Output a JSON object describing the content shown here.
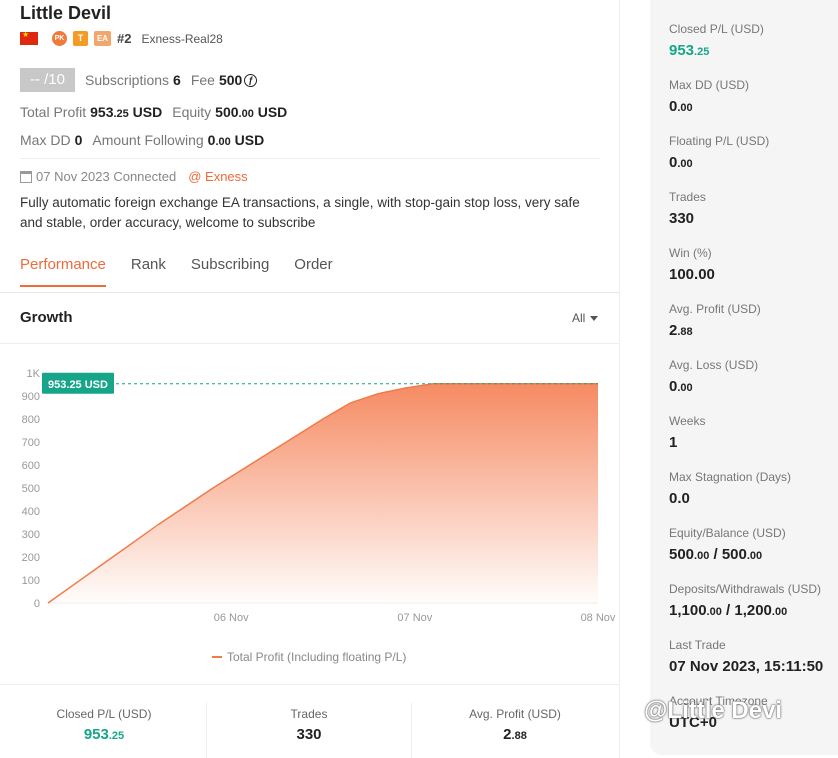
{
  "header": {
    "title": "Little Devil",
    "badges": [
      "PK",
      "T",
      "EA"
    ],
    "rank": "#2",
    "account": "Exness-Real28"
  },
  "summary": {
    "score": "-- /10",
    "subscriptions_label": "Subscriptions",
    "subscriptions_value": "6",
    "fee_label": "Fee",
    "fee_value": "500",
    "fee_icon": "ƒ",
    "total_profit_label": "Total Profit",
    "total_profit_int": "953",
    "total_profit_dec": ".25",
    "total_profit_unit": " USD",
    "equity_label": "Equity",
    "equity_int": "500",
    "equity_dec": ".00",
    "equity_unit": " USD",
    "maxdd_label": "Max DD",
    "maxdd_value": "0",
    "amount_following_label": "Amount Following",
    "amount_following_int": "0",
    "amount_following_dec": ".00",
    "amount_following_unit": " USD"
  },
  "connection": {
    "date": "07 Nov 2023 Connected",
    "broker": "@ Exness"
  },
  "description": "Fully automatic foreign exchange EA transactions, a single, with stop-gain stop loss, very safe and stable, order accuracy, welcome to subscribe",
  "tabs": [
    {
      "label": "Performance",
      "active": true
    },
    {
      "label": "Rank",
      "active": false
    },
    {
      "label": "Subscribing",
      "active": false
    },
    {
      "label": "Order",
      "active": false
    }
  ],
  "growth": {
    "title": "Growth",
    "range": "All"
  },
  "chart_data": {
    "type": "area",
    "title": "",
    "xlabel": "",
    "ylabel": "",
    "ylim": [
      0,
      1000
    ],
    "yticks": [
      "0",
      "100",
      "200",
      "300",
      "400",
      "500",
      "600",
      "700",
      "800",
      "900",
      "1K"
    ],
    "xticks": [
      "06 Nov",
      "07 Nov",
      "08 Nov"
    ],
    "x": [
      0,
      0.1,
      0.2,
      0.3,
      0.4,
      0.5,
      0.55,
      0.6,
      0.65,
      0.7,
      0.75,
      1.0
    ],
    "series": [
      {
        "name": "Total Profit (Including floating P/L)",
        "values": [
          0,
          170,
          340,
          500,
          650,
          800,
          870,
          910,
          935,
          953.25,
          953.25,
          953.25
        ]
      }
    ],
    "annotation": "953.25 USD",
    "legend_position": "bottom",
    "colors": {
      "line": "#f07a4a",
      "fill_top": "#f5845a",
      "label_bg": "#17a589"
    }
  },
  "bottom_stats": [
    {
      "label": "Closed P/L (USD)",
      "int": "953",
      "dec": ".25",
      "green": true
    },
    {
      "label": "Trades",
      "int": "330",
      "dec": "",
      "green": false
    },
    {
      "label": "Avg. Profit (USD)",
      "int": "2",
      "dec": ".88",
      "green": false
    }
  ],
  "sidebar": [
    {
      "label": "Closed P/L (USD)",
      "int": "953",
      "dec": ".25",
      "green": true
    },
    {
      "label": "Max DD (USD)",
      "int": "0",
      "dec": ".00"
    },
    {
      "label": "Floating P/L (USD)",
      "int": "0",
      "dec": ".00"
    },
    {
      "label": "Trades",
      "int": "330",
      "dec": ""
    },
    {
      "label": "Win (%)",
      "int": "100.00",
      "dec": ""
    },
    {
      "label": "Avg. Profit (USD)",
      "int": "2",
      "dec": ".88"
    },
    {
      "label": "Avg. Loss (USD)",
      "int": "0",
      "dec": ".00"
    },
    {
      "label": "Weeks",
      "int": "1",
      "dec": ""
    },
    {
      "label": "Max Stagnation (Days)",
      "int": "0.0",
      "dec": ""
    },
    {
      "label": "Equity/Balance (USD)",
      "int": "500",
      "dec": ".00",
      "int2": "500",
      "dec2": ".00"
    },
    {
      "label": "Deposits/Withdrawals (USD)",
      "int": "1,100",
      "dec": ".00",
      "int2": "1,200",
      "dec2": ".00"
    },
    {
      "label": "Last Trade",
      "int": "07 Nov 2023, 15:11:50",
      "dec": ""
    },
    {
      "label": "Account Timezone",
      "int": "UTC+0",
      "dec": ""
    }
  ],
  "watermark": "@Little Devi",
  "colors": {
    "accent": "#f06a3a",
    "green": "#17a589"
  }
}
